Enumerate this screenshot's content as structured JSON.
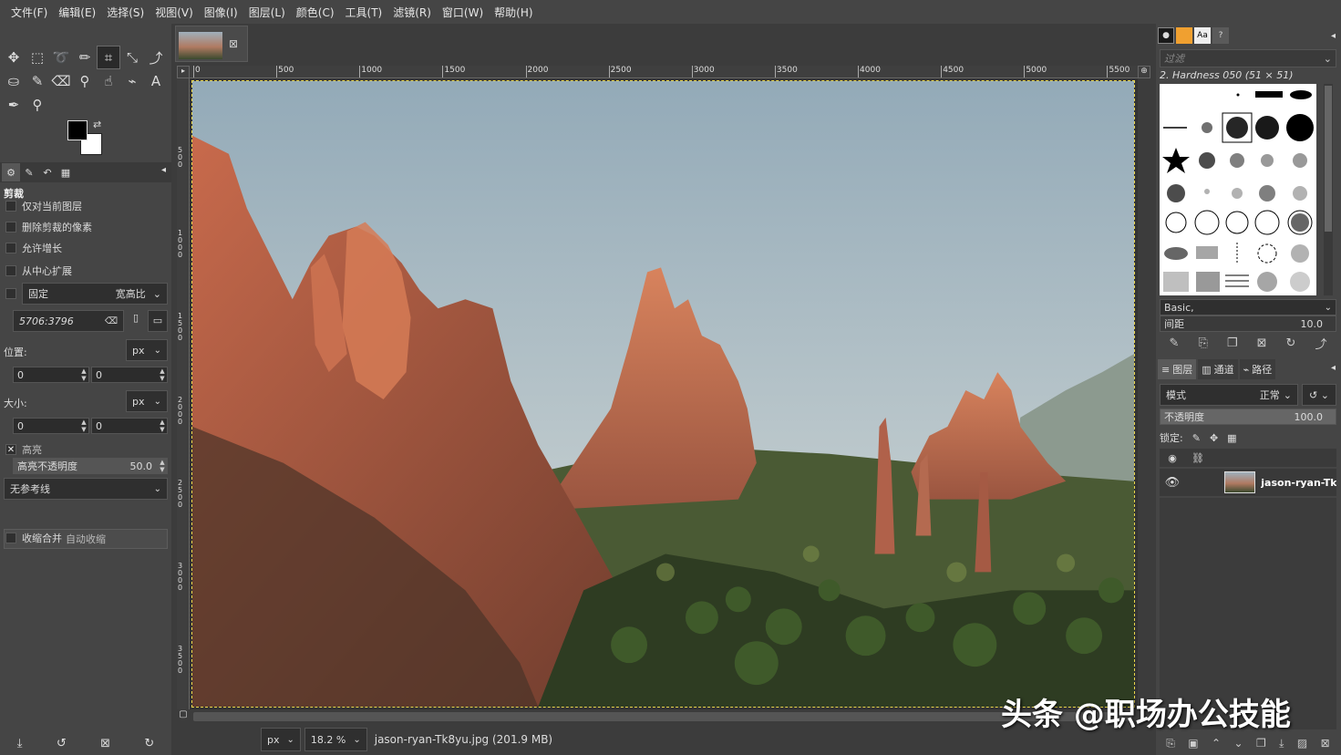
{
  "menubar": [
    "文件(F)",
    "编辑(E)",
    "选择(S)",
    "视图(V)",
    "图像(I)",
    "图层(L)",
    "颜色(C)",
    "工具(T)",
    "滤镜(R)",
    "窗口(W)",
    "帮助(H)"
  ],
  "toolbox": {
    "tools": [
      {
        "name": "move-tool-icon",
        "glyph": "✥"
      },
      {
        "name": "rect-select-tool-icon",
        "glyph": "⬚"
      },
      {
        "name": "free-select-tool-icon",
        "glyph": "➰"
      },
      {
        "name": "fuzzy-select-tool-icon",
        "glyph": "✏"
      },
      {
        "name": "crop-tool-icon",
        "glyph": "⌗"
      },
      {
        "name": "unified-transform-tool-icon",
        "glyph": "⤡"
      },
      {
        "name": "warp-tool-icon",
        "glyph": "⤴"
      },
      {
        "name": "bucket-fill-tool-icon",
        "glyph": "⛀"
      },
      {
        "name": "paintbrush-tool-icon",
        "glyph": "✎"
      },
      {
        "name": "eraser-tool-icon",
        "glyph": "⌫"
      },
      {
        "name": "clone-tool-icon",
        "glyph": "⚲"
      },
      {
        "name": "smudge-tool-icon",
        "glyph": "☝"
      },
      {
        "name": "paths-tool-icon",
        "glyph": "⌁"
      },
      {
        "name": "text-tool-icon",
        "glyph": "A"
      },
      {
        "name": "color-picker-tool-icon",
        "glyph": "✒"
      },
      {
        "name": "zoom-tool-icon",
        "glyph": "⚲"
      }
    ],
    "options_title": "剪裁",
    "opt_current_layer": "仅对当前图层",
    "opt_delete_pixels": "删除剪裁的像素",
    "opt_allow_grow": "允许增长",
    "opt_expand_center": "从中心扩展",
    "fixed_label": "固定",
    "fixed_value": "宽高比",
    "ratio_value": "5706:3796",
    "position_label": "位置:",
    "size_label": "大小:",
    "unit": "px",
    "pos_x": "0",
    "pos_y": "0",
    "size_w": "0",
    "size_h": "0",
    "highlight_label": "高亮",
    "highlight_opacity_label": "高亮不透明度",
    "highlight_opacity_value": "50.0",
    "guides_value": "无参考线",
    "auto_shrink": "自动收缩",
    "shrink_merged": "收缩合并"
  },
  "ruler": {
    "h_labels": [
      "0",
      "500",
      "1000",
      "1500",
      "2000",
      "2500",
      "3000",
      "3500",
      "4000",
      "4500",
      "5000",
      "5500"
    ],
    "v_labels": [
      "500",
      "1000",
      "1500",
      "2000",
      "2500",
      "3000",
      "3500"
    ]
  },
  "status": {
    "unit": "px",
    "zoom": "18.2 %",
    "file": "jason-ryan-Tk8yu.jpg (201.9 MB)"
  },
  "right": {
    "filter_placeholder": "过滤",
    "brush_name": "2. Hardness 050 (51 × 51)",
    "preset": "Basic,",
    "spacing_label": "间距",
    "spacing_value": "10.0",
    "tab_layers": "图层",
    "tab_channels": "通道",
    "tab_paths": "路径",
    "mode_label": "模式",
    "mode_value": "正常",
    "opacity_label": "不透明度",
    "opacity_value": "100.0",
    "lock_label": "锁定:",
    "layer_name": "jason-ryan-Tk"
  },
  "watermark": "头条 @职场办公技能"
}
